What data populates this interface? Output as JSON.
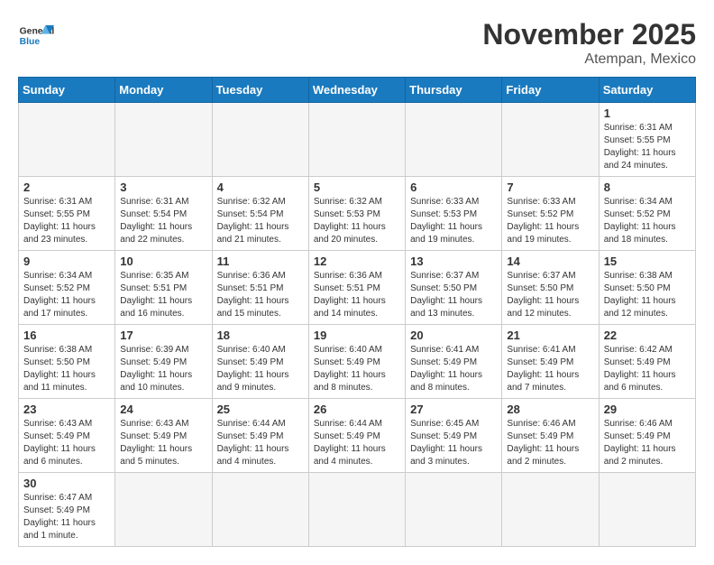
{
  "header": {
    "logo_general": "General",
    "logo_blue": "Blue",
    "month_title": "November 2025",
    "location": "Atempan, Mexico"
  },
  "weekdays": [
    "Sunday",
    "Monday",
    "Tuesday",
    "Wednesday",
    "Thursday",
    "Friday",
    "Saturday"
  ],
  "weeks": [
    [
      {
        "day": "",
        "empty": true
      },
      {
        "day": "",
        "empty": true
      },
      {
        "day": "",
        "empty": true
      },
      {
        "day": "",
        "empty": true
      },
      {
        "day": "",
        "empty": true
      },
      {
        "day": "",
        "empty": true
      },
      {
        "day": "1",
        "sunrise": "6:31 AM",
        "sunset": "5:55 PM",
        "daylight": "11 hours and 24 minutes."
      }
    ],
    [
      {
        "day": "2",
        "sunrise": "6:31 AM",
        "sunset": "5:55 PM",
        "daylight": "11 hours and 23 minutes."
      },
      {
        "day": "3",
        "sunrise": "6:31 AM",
        "sunset": "5:54 PM",
        "daylight": "11 hours and 22 minutes."
      },
      {
        "day": "4",
        "sunrise": "6:32 AM",
        "sunset": "5:54 PM",
        "daylight": "11 hours and 21 minutes."
      },
      {
        "day": "5",
        "sunrise": "6:32 AM",
        "sunset": "5:53 PM",
        "daylight": "11 hours and 20 minutes."
      },
      {
        "day": "6",
        "sunrise": "6:33 AM",
        "sunset": "5:53 PM",
        "daylight": "11 hours and 19 minutes."
      },
      {
        "day": "7",
        "sunrise": "6:33 AM",
        "sunset": "5:52 PM",
        "daylight": "11 hours and 19 minutes."
      },
      {
        "day": "8",
        "sunrise": "6:34 AM",
        "sunset": "5:52 PM",
        "daylight": "11 hours and 18 minutes."
      }
    ],
    [
      {
        "day": "9",
        "sunrise": "6:34 AM",
        "sunset": "5:52 PM",
        "daylight": "11 hours and 17 minutes."
      },
      {
        "day": "10",
        "sunrise": "6:35 AM",
        "sunset": "5:51 PM",
        "daylight": "11 hours and 16 minutes."
      },
      {
        "day": "11",
        "sunrise": "6:36 AM",
        "sunset": "5:51 PM",
        "daylight": "11 hours and 15 minutes."
      },
      {
        "day": "12",
        "sunrise": "6:36 AM",
        "sunset": "5:51 PM",
        "daylight": "11 hours and 14 minutes."
      },
      {
        "day": "13",
        "sunrise": "6:37 AM",
        "sunset": "5:50 PM",
        "daylight": "11 hours and 13 minutes."
      },
      {
        "day": "14",
        "sunrise": "6:37 AM",
        "sunset": "5:50 PM",
        "daylight": "11 hours and 12 minutes."
      },
      {
        "day": "15",
        "sunrise": "6:38 AM",
        "sunset": "5:50 PM",
        "daylight": "11 hours and 12 minutes."
      }
    ],
    [
      {
        "day": "16",
        "sunrise": "6:38 AM",
        "sunset": "5:50 PM",
        "daylight": "11 hours and 11 minutes."
      },
      {
        "day": "17",
        "sunrise": "6:39 AM",
        "sunset": "5:49 PM",
        "daylight": "11 hours and 10 minutes."
      },
      {
        "day": "18",
        "sunrise": "6:40 AM",
        "sunset": "5:49 PM",
        "daylight": "11 hours and 9 minutes."
      },
      {
        "day": "19",
        "sunrise": "6:40 AM",
        "sunset": "5:49 PM",
        "daylight": "11 hours and 8 minutes."
      },
      {
        "day": "20",
        "sunrise": "6:41 AM",
        "sunset": "5:49 PM",
        "daylight": "11 hours and 8 minutes."
      },
      {
        "day": "21",
        "sunrise": "6:41 AM",
        "sunset": "5:49 PM",
        "daylight": "11 hours and 7 minutes."
      },
      {
        "day": "22",
        "sunrise": "6:42 AM",
        "sunset": "5:49 PM",
        "daylight": "11 hours and 6 minutes."
      }
    ],
    [
      {
        "day": "23",
        "sunrise": "6:43 AM",
        "sunset": "5:49 PM",
        "daylight": "11 hours and 6 minutes."
      },
      {
        "day": "24",
        "sunrise": "6:43 AM",
        "sunset": "5:49 PM",
        "daylight": "11 hours and 5 minutes."
      },
      {
        "day": "25",
        "sunrise": "6:44 AM",
        "sunset": "5:49 PM",
        "daylight": "11 hours and 4 minutes."
      },
      {
        "day": "26",
        "sunrise": "6:44 AM",
        "sunset": "5:49 PM",
        "daylight": "11 hours and 4 minutes."
      },
      {
        "day": "27",
        "sunrise": "6:45 AM",
        "sunset": "5:49 PM",
        "daylight": "11 hours and 3 minutes."
      },
      {
        "day": "28",
        "sunrise": "6:46 AM",
        "sunset": "5:49 PM",
        "daylight": "11 hours and 2 minutes."
      },
      {
        "day": "29",
        "sunrise": "6:46 AM",
        "sunset": "5:49 PM",
        "daylight": "11 hours and 2 minutes."
      }
    ],
    [
      {
        "day": "30",
        "sunrise": "6:47 AM",
        "sunset": "5:49 PM",
        "daylight": "11 hours and 1 minute."
      },
      {
        "day": "",
        "empty": true
      },
      {
        "day": "",
        "empty": true
      },
      {
        "day": "",
        "empty": true
      },
      {
        "day": "",
        "empty": true
      },
      {
        "day": "",
        "empty": true
      },
      {
        "day": "",
        "empty": true
      }
    ]
  ]
}
